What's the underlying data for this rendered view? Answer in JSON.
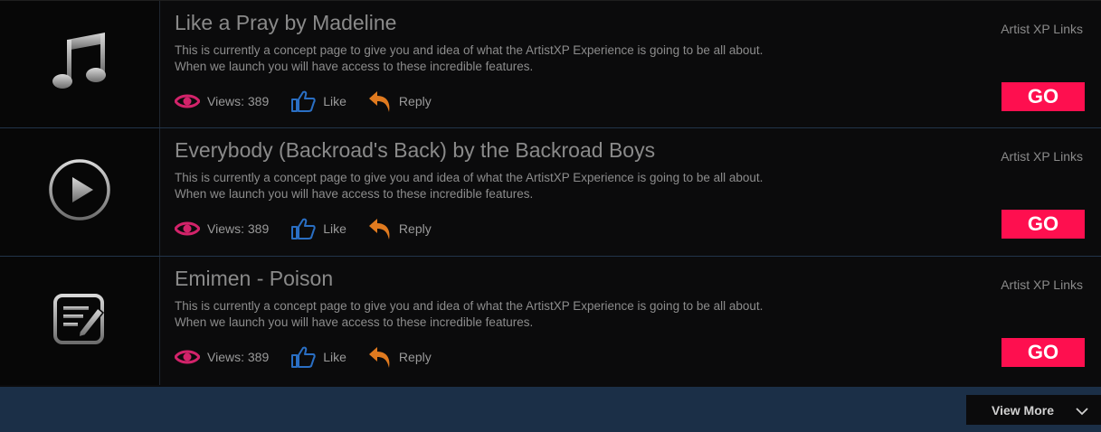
{
  "items": [
    {
      "title": "Like a Pray by Madeline",
      "icon": "music-note-icon",
      "desc_line1": "This is currently a concept page to give you and idea of what the ArtistXP Experience is going to be all about.",
      "desc_line2": "When we launch you will have access to these incredible features.",
      "views_label": "Views: 389",
      "like_label": "Like",
      "reply_label": "Reply",
      "links_label": "Artist XP Links",
      "go_label": "GO"
    },
    {
      "title": "Everybody (Backroad's Back) by the Backroad Boys",
      "icon": "play-circle-icon",
      "desc_line1": "This is currently a concept page to give you and idea of what the ArtistXP Experience is going to be all about.",
      "desc_line2": "When we launch you will have access to these incredible features.",
      "views_label": "Views: 389",
      "like_label": "Like",
      "reply_label": "Reply",
      "links_label": "Artist XP Links",
      "go_label": "GO"
    },
    {
      "title": "Emimen - Poison",
      "icon": "note-edit-icon",
      "desc_line1": "This is currently a concept page to give you and idea of what the ArtistXP Experience is going to be all about.",
      "desc_line2": "When we launch you will have access to these incredible features.",
      "views_label": "Views: 389",
      "like_label": "Like",
      "reply_label": "Reply",
      "links_label": "Artist XP Links",
      "go_label": "GO"
    }
  ],
  "view_more_label": "View More",
  "colors": {
    "accent": "#fe0f4f",
    "eye": "#d2236a",
    "like": "#2a6fc4",
    "reply": "#e07a1f",
    "footer_bg": "#1b2f47"
  }
}
